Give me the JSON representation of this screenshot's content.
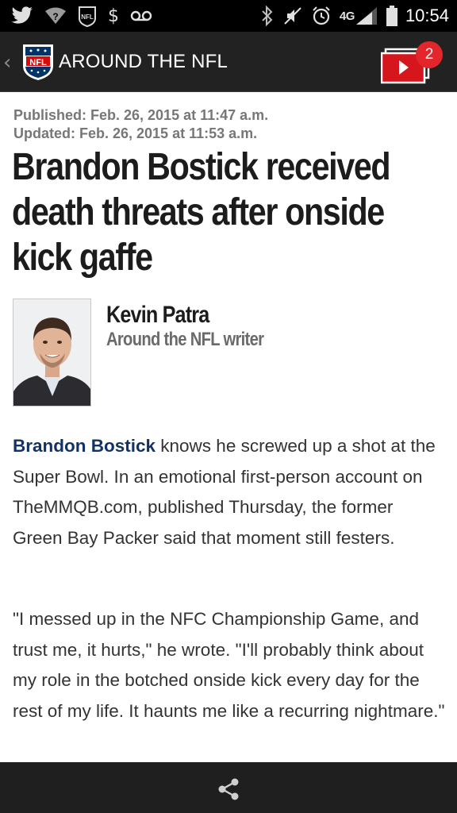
{
  "status_bar": {
    "time": "10:54",
    "network": "4G",
    "left_icons": [
      "twitter-icon",
      "wifi-question-icon",
      "nfl-notification-icon",
      "dollar-icon",
      "voicemail-icon"
    ],
    "right_icons": [
      "bluetooth-icon",
      "mute-icon",
      "alarm-icon",
      "lte-signal-icon",
      "battery-icon"
    ]
  },
  "app_bar": {
    "title": "AROUND THE NFL",
    "logo_text": "NFL",
    "notification_count": "2"
  },
  "article": {
    "published": "Published: Feb. 26, 2015 at 11:47 a.m.",
    "updated": "Updated: Feb. 26, 2015 at 11:53 a.m.",
    "headline": "Brandon Bostick received death threats after onside kick gaffe",
    "author": {
      "name": "Kevin Patra",
      "role": "Around the NFL writer"
    },
    "paragraphs": [
      {
        "link": "Brandon Bostick",
        "text": " knows he screwed up a shot at the Super Bowl. In an emotional first-person account on TheMMQB.com, published Thursday, the former Green Bay Packer said that moment still festers."
      },
      {
        "text": "\"I messed up in the NFC Championship Game, and trust me, it hurts,\" he wrote. \"I'll probably think about my role in the botched onside kick every day for the rest of my life. It haunts me like a recurring nightmare.\""
      }
    ]
  },
  "colors": {
    "app_bar_bg": "#222222",
    "badge": "#e3262b",
    "link": "#14325f",
    "nfl_blue": "#013369"
  }
}
